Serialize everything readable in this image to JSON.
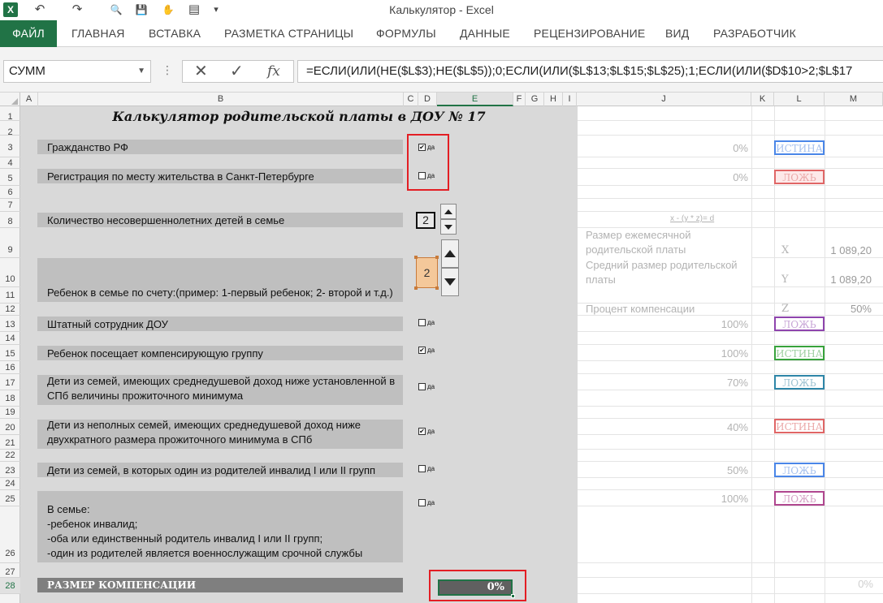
{
  "window": {
    "title": "Калькулятор - Excel"
  },
  "colors": {
    "excel_green": "#217346",
    "highlight_red": "#e31e24"
  },
  "quick_access": [
    {
      "name": "excel-logo-icon",
      "glyph": "X"
    },
    {
      "name": "undo-icon",
      "glyph": "↶"
    },
    {
      "name": "redo-icon",
      "glyph": "↷"
    },
    {
      "name": "print-preview-icon",
      "glyph": "🔍"
    },
    {
      "name": "save-icon",
      "glyph": "💾"
    },
    {
      "name": "touch-mode-icon",
      "glyph": "✋"
    },
    {
      "name": "form-icon",
      "glyph": "▤"
    },
    {
      "name": "customize-icon",
      "glyph": "▾"
    }
  ],
  "ribbon": {
    "tabs": [
      "ФАЙЛ",
      "ГЛАВНАЯ",
      "ВСТАВКА",
      "РАЗМЕТКА СТРАНИЦЫ",
      "ФОРМУЛЫ",
      "ДАННЫЕ",
      "РЕЦЕНЗИРОВАНИЕ",
      "ВИД",
      "РАЗРАБОТЧИК"
    ]
  },
  "formula_bar": {
    "name_box": "СУММ",
    "cancel": "✕",
    "enter": "✓",
    "fx": "fx",
    "formula": "=ЕСЛИ(ИЛИ(НЕ($L$3);НЕ($L$5));0;ЕСЛИ(ИЛИ($L$13;$L$15;$L$25);1;ЕСЛИ(ИЛИ($D$10>2;$L$17"
  },
  "columns": [
    "A",
    "B",
    "C",
    "D",
    "E",
    "F",
    "G",
    "H",
    "I",
    "J",
    "K",
    "L",
    "M"
  ],
  "rows": [
    "1",
    "2",
    "3",
    "4",
    "5",
    "6",
    "7",
    "8",
    "9",
    "10",
    "11",
    "12",
    "13",
    "14",
    "15",
    "16",
    "17",
    "18",
    "19",
    "20",
    "21",
    "22",
    "23",
    "24",
    "25",
    "26",
    "27",
    "28"
  ],
  "sheet": {
    "title": "Калькулятор родительской платы в ДОУ № 17",
    "labels": {
      "citizenship": "Гражданство РФ",
      "registration": "Регистрация по месту жительства в Санкт-Петербурге",
      "children_count": "Количество несовершеннолетних детей в семье",
      "child_order": "Ребенок в семье по счету:(пример: 1-первый ребенок; 2- второй и т.д.)",
      "staff": "Штатный сотрудник ДОУ",
      "compensating": "Ребенок посещает компенсирующую группу",
      "low_income": "Дети из семей, имеющих среднедушевой доход ниже установленной в СПб величины прожиточного минимума",
      "single_parent": "Дети из неполных семей, имеющих среднедушевой доход ниже двухкратного размера прожиточного минимума в СПб",
      "disabled_parent": "Дети из семей, в которых один из родителей инвалид I или II групп",
      "family_lines": [
        "В семье:",
        "-ребенок инвалид;",
        "-оба или единственный родитель инвалид I или II групп;",
        "-один из родителей является военнослужащим срочной службы"
      ],
      "compensation": "РАЗМЕР КОМПЕНСАЦИИ"
    },
    "checkbox_label": "да",
    "checks": {
      "citizenship": "✔",
      "registration": "",
      "staff": "",
      "compensating": "✔",
      "low_income": "",
      "single_parent": "✔",
      "disabled_parent": "",
      "family": ""
    },
    "spinners": {
      "children_count": "2",
      "child_order": "2"
    },
    "result": "0%"
  },
  "side_panel": {
    "formula_hint": "x - (y * z)= d",
    "monthly_label": "Размер ежемесячной родительской платы",
    "average_label": "Средний размер родительской платы",
    "percent_label": "Процент компенсации",
    "x_letter": "X",
    "y_letter": "Y",
    "z_letter": "Z",
    "x_value": "1 089,20",
    "y_value": "1 089,20",
    "z_value": "50%",
    "rows": [
      {
        "row": "3",
        "pct": "0%",
        "bool": "ИСТИНА",
        "color": "#4a86e8"
      },
      {
        "row": "5",
        "pct": "0%",
        "bool": "ЛОЖЬ",
        "color": "#e06666"
      },
      {
        "row": "13",
        "pct": "100%",
        "bool": "ЛОЖЬ",
        "color": "#8e44ad"
      },
      {
        "row": "15",
        "pct": "100%",
        "bool": "ИСТИНА",
        "color": "#38a33c"
      },
      {
        "row": "17",
        "pct": "70%",
        "bool": "ЛОЖЬ",
        "color": "#2e86a8"
      },
      {
        "row": "20",
        "pct": "40%",
        "bool": "ИСТИНА",
        "color": "#e06666"
      },
      {
        "row": "23",
        "pct": "50%",
        "bool": "ЛОЖЬ",
        "color": "#4a86e8"
      },
      {
        "row": "25",
        "pct": "100%",
        "bool": "ЛОЖЬ",
        "color": "#b0478f"
      }
    ],
    "m28": "0%"
  }
}
